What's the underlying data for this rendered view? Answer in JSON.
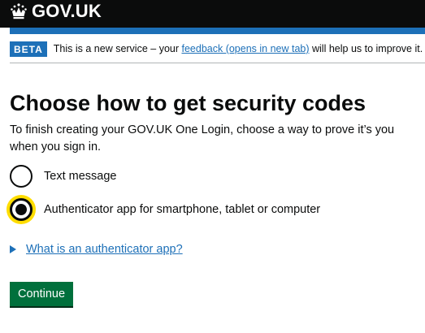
{
  "header": {
    "logo_text": "GOV.UK",
    "logo_icon": "crown-icon"
  },
  "phase_banner": {
    "tag": "BETA",
    "text_before": "This is a new service – your ",
    "link_text": "feedback (opens in new tab)",
    "text_after": " will help us to improve it."
  },
  "page": {
    "title": "Choose how to get security codes",
    "intro": "To finish creating your GOV.UK One Login, choose a way to prove it’s you when you sign in."
  },
  "options": [
    {
      "label": "Text message",
      "checked": false
    },
    {
      "label": "Authenticator app for smartphone, tablet or computer",
      "checked": true
    }
  ],
  "details": {
    "summary": "What is an authenticator app?"
  },
  "actions": {
    "continue_label": "Continue"
  },
  "colors": {
    "header": "#0b0c0c",
    "brand_blue": "#1d70b8",
    "button_green": "#00703c",
    "focus_yellow": "#ffdd00"
  }
}
